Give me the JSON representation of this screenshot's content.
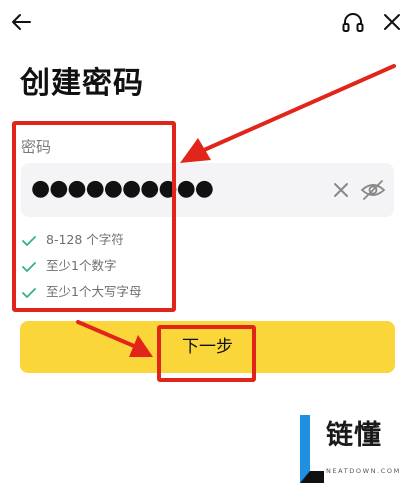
{
  "topbar": {
    "back_icon": "arrow-left-icon",
    "support_icon": "headset-icon",
    "close_icon": "close-icon"
  },
  "page": {
    "title": "创建密码"
  },
  "password": {
    "label": "密码",
    "value": "●●●●●●●●●●",
    "clear_icon": "clear-x-icon",
    "visibility_icon": "eye-slash-icon"
  },
  "rules": [
    {
      "text": "8-128 个字符",
      "status": "met",
      "icon": "check-icon"
    },
    {
      "text": "至少1个数字",
      "status": "met",
      "icon": "check-icon"
    },
    {
      "text": "至少1个大写字母",
      "status": "met",
      "icon": "check-icon"
    }
  ],
  "next_button": {
    "label": "下一步"
  },
  "colors": {
    "accent_button": "#fad63b",
    "check": "#35b37e",
    "annotation": "#e1251b",
    "field_bg": "#f4f3f6"
  },
  "watermark": {
    "logo_text": "链懂",
    "logo_subtext": "NEATDOWN.COM"
  }
}
